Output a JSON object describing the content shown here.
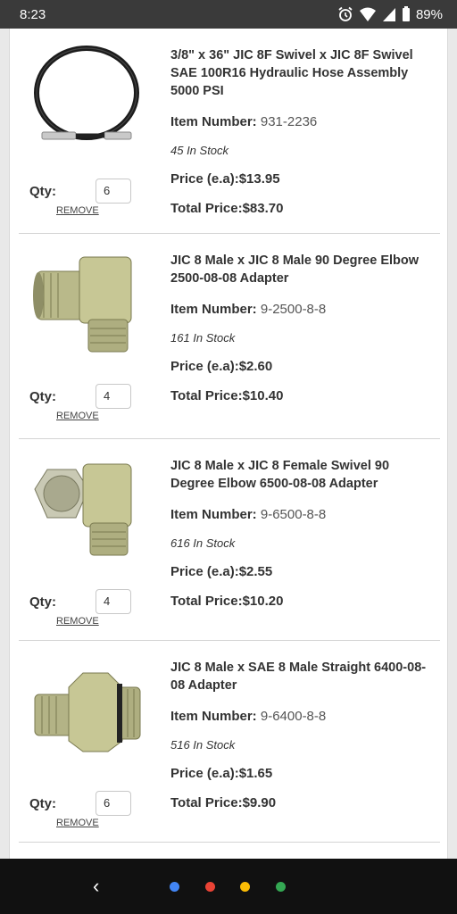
{
  "status_bar": {
    "time": "8:23",
    "battery": "89%",
    "icons": [
      "alarm-icon",
      "wifi-icon",
      "signal-icon",
      "battery-icon"
    ]
  },
  "cart": {
    "items": [
      {
        "title": "3/8\" x 36\" JIC 8F Swivel x JIC 8F Swivel SAE 100R16 Hydraulic Hose Assembly 5000 PSI",
        "item_number_label": "Item Number:",
        "item_number": "931-2236",
        "stock": "45 In Stock",
        "price_label": "Price (e.a):",
        "price": "$13.95",
        "total_label": "Total Price:",
        "total": "$83.70",
        "qty_label": "Qty:",
        "qty": "6",
        "remove_label": "REMOVE",
        "image": "hydraulic-hose"
      },
      {
        "title": "JIC 8 Male x JIC 8 Male 90 Degree Elbow 2500-08-08 Adapter",
        "item_number_label": "Item Number:",
        "item_number": "9-2500-8-8",
        "stock": "161 In Stock",
        "price_label": "Price (e.a):",
        "price": "$2.60",
        "total_label": "Total Price:",
        "total": "$10.40",
        "qty_label": "Qty:",
        "qty": "4",
        "remove_label": "REMOVE",
        "image": "elbow-adapter"
      },
      {
        "title": "JIC 8 Male x JIC 8 Female Swivel 90 Degree Elbow 6500-08-08 Adapter",
        "item_number_label": "Item Number:",
        "item_number": "9-6500-8-8",
        "stock": "616 In Stock",
        "price_label": "Price (e.a):",
        "price": "$2.55",
        "total_label": "Total Price:",
        "total": "$10.20",
        "qty_label": "Qty:",
        "qty": "4",
        "remove_label": "REMOVE",
        "image": "swivel-elbow-adapter"
      },
      {
        "title": "JIC 8 Male x SAE 8 Male Straight 6400-08-08 Adapter",
        "item_number_label": "Item Number:",
        "item_number": "9-6400-8-8",
        "stock": "516 In Stock",
        "price_label": "Price (e.a):",
        "price": "$1.65",
        "total_label": "Total Price:",
        "total": "$9.90",
        "qty_label": "Qty:",
        "qty": "6",
        "remove_label": "REMOVE",
        "image": "straight-adapter"
      }
    ]
  },
  "nav_bar": {
    "dot_colors": [
      "#4285F4",
      "#EA4335",
      "#FBBC05",
      "#34A853"
    ]
  }
}
